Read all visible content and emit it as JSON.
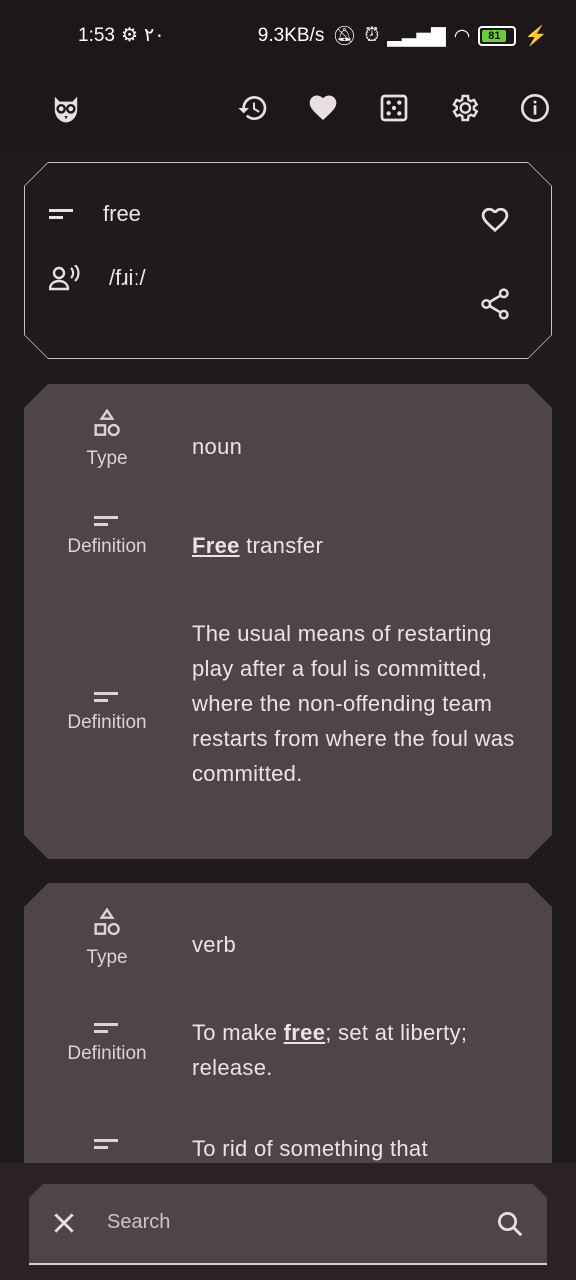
{
  "status": {
    "time": "1:53",
    "extra": "٢٠",
    "net_speed": "9.3KB/s",
    "battery": "81"
  },
  "word": {
    "text": "free",
    "pronunciation": "/fɹiː/"
  },
  "entries": [
    {
      "type_label": "Type",
      "type_value": "noun",
      "definitions": [
        {
          "label": "Definition",
          "bold": "Free",
          "rest": " transfer"
        },
        {
          "label": "Definition",
          "text": "The usual means of restarting play after a foul is committed, where the non-offending team restarts from where the foul was committed."
        }
      ]
    },
    {
      "type_label": "Type",
      "type_value": "verb",
      "definitions": [
        {
          "label": "Definition",
          "pre": "To make ",
          "bold": "free",
          "rest": "; set at liberty; release."
        },
        {
          "label": "",
          "text": "To rid of something that"
        }
      ]
    }
  ],
  "search": {
    "placeholder": "Search"
  }
}
